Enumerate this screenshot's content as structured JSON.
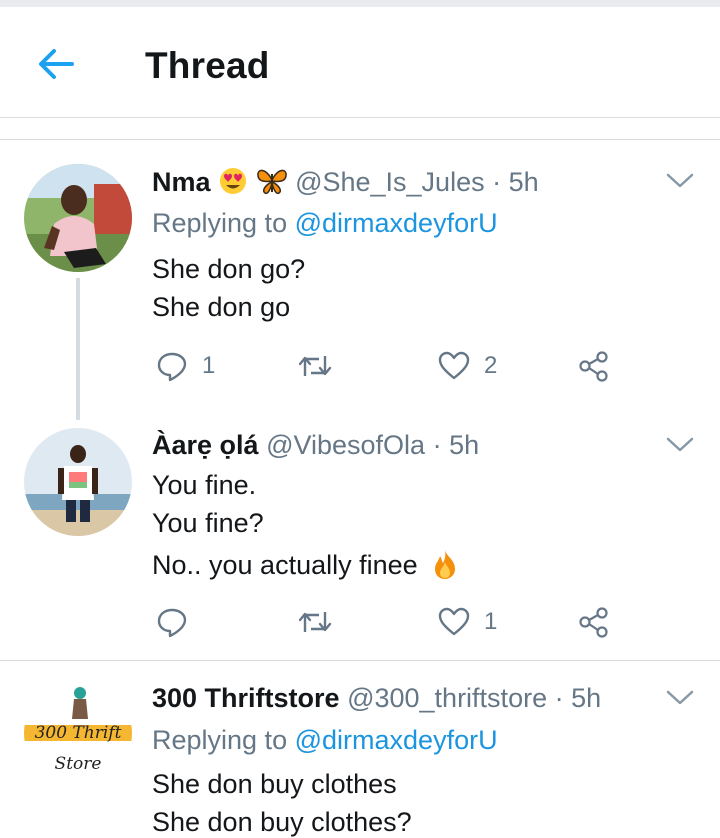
{
  "header": {
    "title": "Thread"
  },
  "tweets": [
    {
      "name": "Nma",
      "handle": "@She_Is_Jules",
      "sep": "·",
      "time": "5h",
      "reply_prefix": "Replying to",
      "reply_to": "@dirmaxdeyforU",
      "lines": [
        "She don go?",
        "She don go"
      ],
      "reply_count": "1",
      "like_count": "2"
    },
    {
      "name": "Àarẹ ọlá",
      "handle": "@VibesofOla",
      "sep": "·",
      "time": "5h",
      "lines": [
        "You fine.",
        "You fine?",
        "No.. you actually finee"
      ],
      "reply_count": "",
      "like_count": "1"
    },
    {
      "name": "300 Thriftstore",
      "handle": "@300_thriftstore",
      "sep": "·",
      "time": "5h",
      "reply_prefix": "Replying to",
      "reply_to": "@dirmaxdeyforU",
      "lines": [
        "She don buy clothes",
        "She don buy clothes?"
      ],
      "logo_text_1": "300 Thrift",
      "logo_text_2": "Store"
    }
  ],
  "colors": {
    "accent": "#1da1f2",
    "muted": "#657786",
    "text": "#14171a"
  }
}
